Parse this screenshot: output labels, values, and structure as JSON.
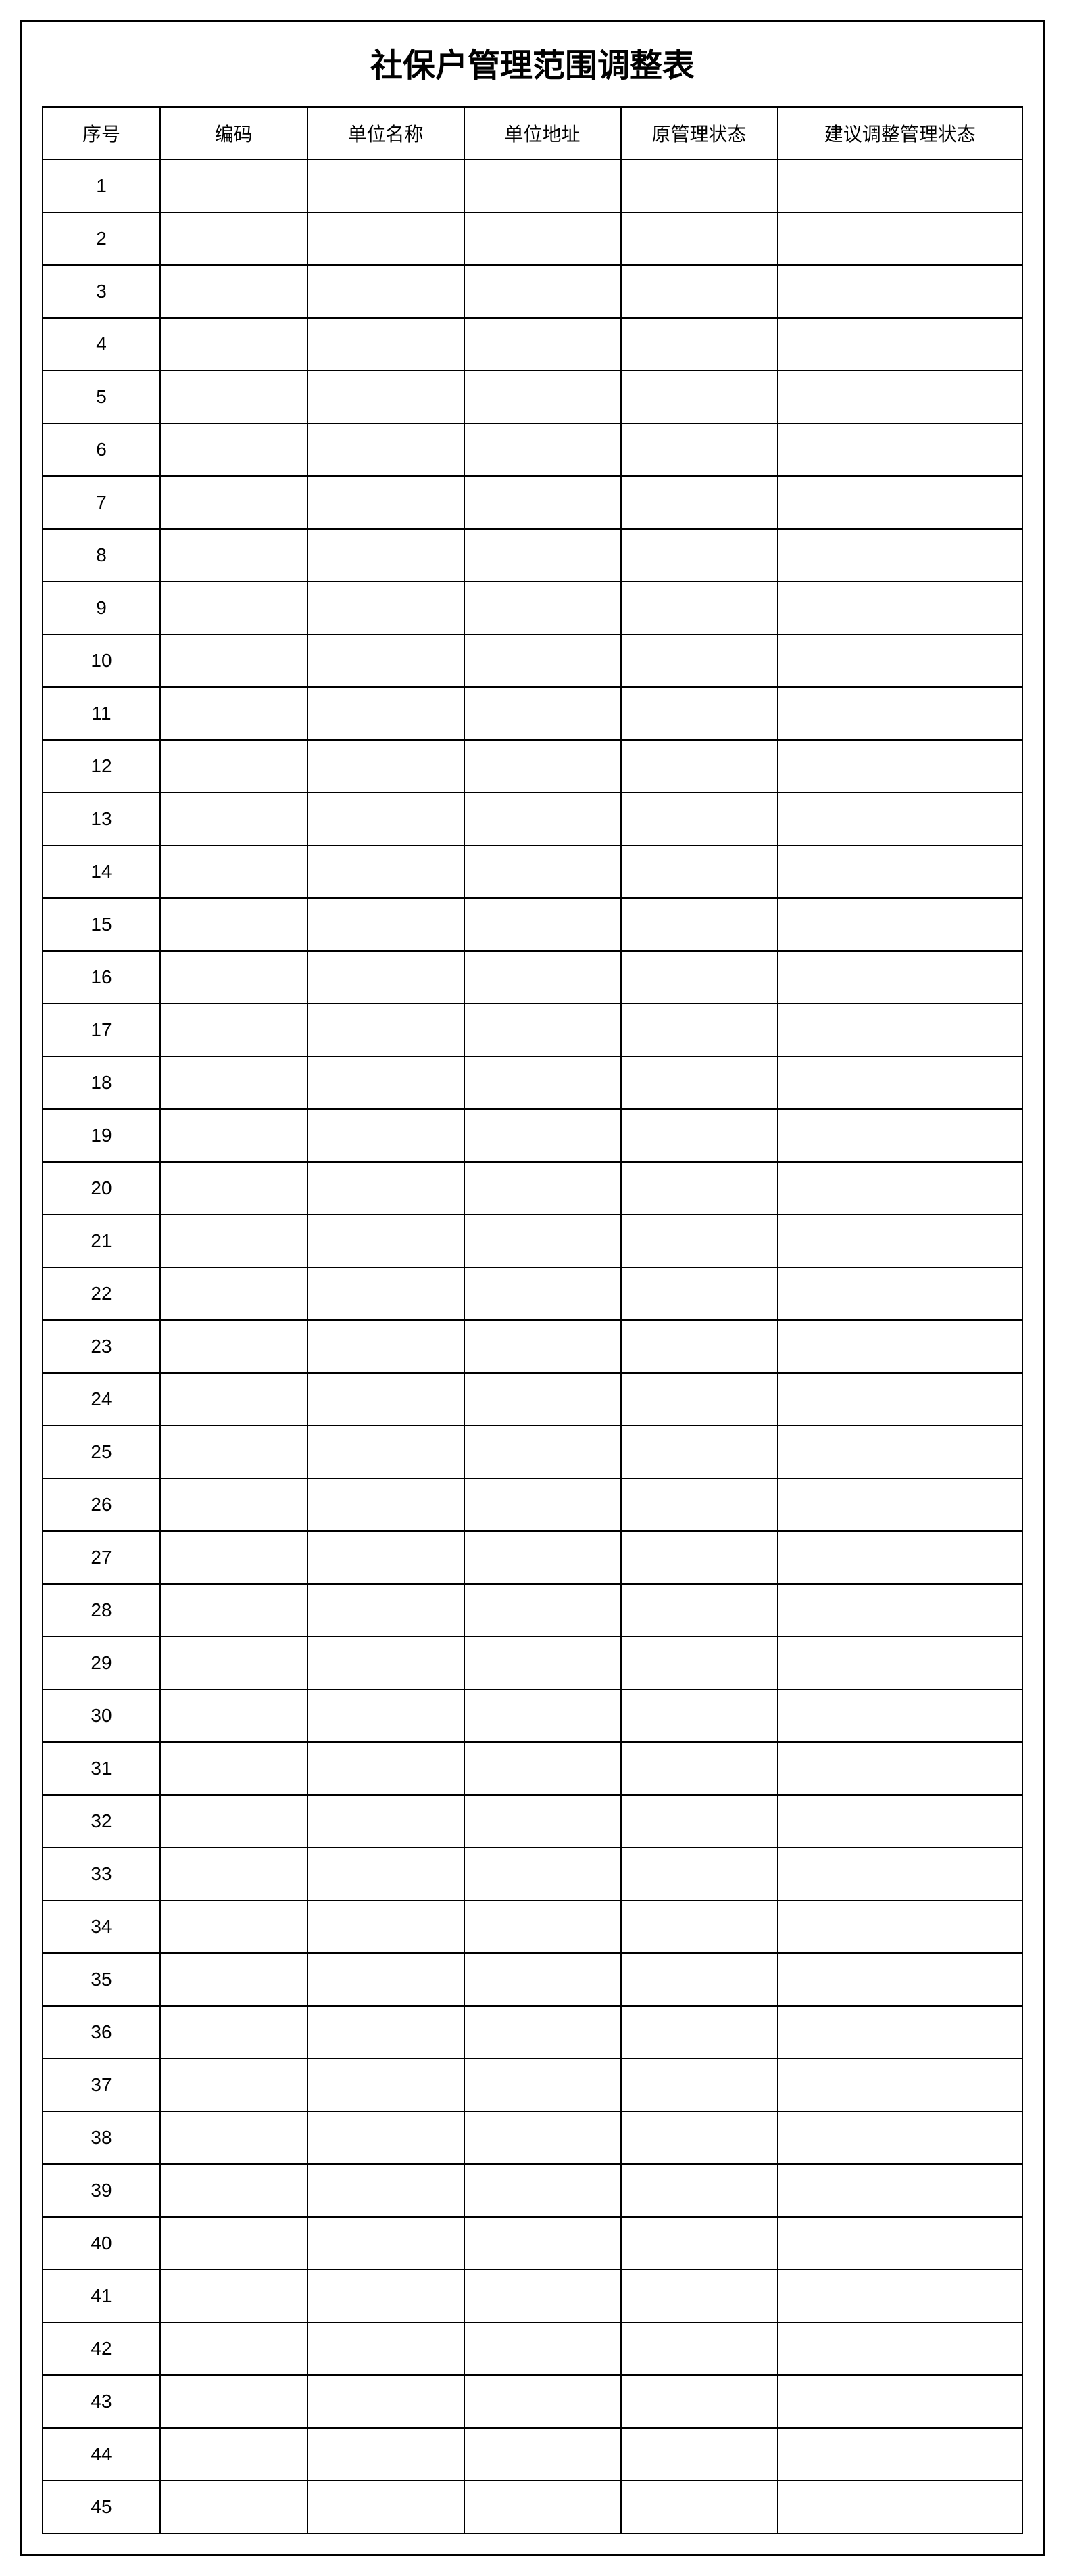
{
  "title": "社保户管理范围调整表",
  "columns": [
    {
      "key": "seq",
      "label": "序号"
    },
    {
      "key": "code",
      "label": "编码"
    },
    {
      "key": "unit_name",
      "label": "单位名称"
    },
    {
      "key": "unit_addr",
      "label": "单位地址"
    },
    {
      "key": "orig_status",
      "label": "原管理状态"
    },
    {
      "key": "suggest_status",
      "label": "建议调整管理状态"
    }
  ],
  "rows": [
    {
      "seq": "1",
      "code": "",
      "unit_name": "",
      "unit_addr": "",
      "orig_status": "",
      "suggest_status": ""
    },
    {
      "seq": "2",
      "code": "",
      "unit_name": "",
      "unit_addr": "",
      "orig_status": "",
      "suggest_status": ""
    },
    {
      "seq": "3",
      "code": "",
      "unit_name": "",
      "unit_addr": "",
      "orig_status": "",
      "suggest_status": ""
    },
    {
      "seq": "4",
      "code": "",
      "unit_name": "",
      "unit_addr": "",
      "orig_status": "",
      "suggest_status": ""
    },
    {
      "seq": "5",
      "code": "",
      "unit_name": "",
      "unit_addr": "",
      "orig_status": "",
      "suggest_status": ""
    },
    {
      "seq": "6",
      "code": "",
      "unit_name": "",
      "unit_addr": "",
      "orig_status": "",
      "suggest_status": ""
    },
    {
      "seq": "7",
      "code": "",
      "unit_name": "",
      "unit_addr": "",
      "orig_status": "",
      "suggest_status": ""
    },
    {
      "seq": "8",
      "code": "",
      "unit_name": "",
      "unit_addr": "",
      "orig_status": "",
      "suggest_status": ""
    },
    {
      "seq": "9",
      "code": "",
      "unit_name": "",
      "unit_addr": "",
      "orig_status": "",
      "suggest_status": ""
    },
    {
      "seq": "10",
      "code": "",
      "unit_name": "",
      "unit_addr": "",
      "orig_status": "",
      "suggest_status": ""
    },
    {
      "seq": "11",
      "code": "",
      "unit_name": "",
      "unit_addr": "",
      "orig_status": "",
      "suggest_status": ""
    },
    {
      "seq": "12",
      "code": "",
      "unit_name": "",
      "unit_addr": "",
      "orig_status": "",
      "suggest_status": ""
    },
    {
      "seq": "13",
      "code": "",
      "unit_name": "",
      "unit_addr": "",
      "orig_status": "",
      "suggest_status": ""
    },
    {
      "seq": "14",
      "code": "",
      "unit_name": "",
      "unit_addr": "",
      "orig_status": "",
      "suggest_status": ""
    },
    {
      "seq": "15",
      "code": "",
      "unit_name": "",
      "unit_addr": "",
      "orig_status": "",
      "suggest_status": ""
    },
    {
      "seq": "16",
      "code": "",
      "unit_name": "",
      "unit_addr": "",
      "orig_status": "",
      "suggest_status": ""
    },
    {
      "seq": "17",
      "code": "",
      "unit_name": "",
      "unit_addr": "",
      "orig_status": "",
      "suggest_status": ""
    },
    {
      "seq": "18",
      "code": "",
      "unit_name": "",
      "unit_addr": "",
      "orig_status": "",
      "suggest_status": ""
    },
    {
      "seq": "19",
      "code": "",
      "unit_name": "",
      "unit_addr": "",
      "orig_status": "",
      "suggest_status": ""
    },
    {
      "seq": "20",
      "code": "",
      "unit_name": "",
      "unit_addr": "",
      "orig_status": "",
      "suggest_status": ""
    },
    {
      "seq": "21",
      "code": "",
      "unit_name": "",
      "unit_addr": "",
      "orig_status": "",
      "suggest_status": ""
    },
    {
      "seq": "22",
      "code": "",
      "unit_name": "",
      "unit_addr": "",
      "orig_status": "",
      "suggest_status": ""
    },
    {
      "seq": "23",
      "code": "",
      "unit_name": "",
      "unit_addr": "",
      "orig_status": "",
      "suggest_status": ""
    },
    {
      "seq": "24",
      "code": "",
      "unit_name": "",
      "unit_addr": "",
      "orig_status": "",
      "suggest_status": ""
    },
    {
      "seq": "25",
      "code": "",
      "unit_name": "",
      "unit_addr": "",
      "orig_status": "",
      "suggest_status": ""
    },
    {
      "seq": "26",
      "code": "",
      "unit_name": "",
      "unit_addr": "",
      "orig_status": "",
      "suggest_status": ""
    },
    {
      "seq": "27",
      "code": "",
      "unit_name": "",
      "unit_addr": "",
      "orig_status": "",
      "suggest_status": ""
    },
    {
      "seq": "28",
      "code": "",
      "unit_name": "",
      "unit_addr": "",
      "orig_status": "",
      "suggest_status": ""
    },
    {
      "seq": "29",
      "code": "",
      "unit_name": "",
      "unit_addr": "",
      "orig_status": "",
      "suggest_status": ""
    },
    {
      "seq": "30",
      "code": "",
      "unit_name": "",
      "unit_addr": "",
      "orig_status": "",
      "suggest_status": ""
    },
    {
      "seq": "31",
      "code": "",
      "unit_name": "",
      "unit_addr": "",
      "orig_status": "",
      "suggest_status": ""
    },
    {
      "seq": "32",
      "code": "",
      "unit_name": "",
      "unit_addr": "",
      "orig_status": "",
      "suggest_status": ""
    },
    {
      "seq": "33",
      "code": "",
      "unit_name": "",
      "unit_addr": "",
      "orig_status": "",
      "suggest_status": ""
    },
    {
      "seq": "34",
      "code": "",
      "unit_name": "",
      "unit_addr": "",
      "orig_status": "",
      "suggest_status": ""
    },
    {
      "seq": "35",
      "code": "",
      "unit_name": "",
      "unit_addr": "",
      "orig_status": "",
      "suggest_status": ""
    },
    {
      "seq": "36",
      "code": "",
      "unit_name": "",
      "unit_addr": "",
      "orig_status": "",
      "suggest_status": ""
    },
    {
      "seq": "37",
      "code": "",
      "unit_name": "",
      "unit_addr": "",
      "orig_status": "",
      "suggest_status": ""
    },
    {
      "seq": "38",
      "code": "",
      "unit_name": "",
      "unit_addr": "",
      "orig_status": "",
      "suggest_status": ""
    },
    {
      "seq": "39",
      "code": "",
      "unit_name": "",
      "unit_addr": "",
      "orig_status": "",
      "suggest_status": ""
    },
    {
      "seq": "40",
      "code": "",
      "unit_name": "",
      "unit_addr": "",
      "orig_status": "",
      "suggest_status": ""
    },
    {
      "seq": "41",
      "code": "",
      "unit_name": "",
      "unit_addr": "",
      "orig_status": "",
      "suggest_status": ""
    },
    {
      "seq": "42",
      "code": "",
      "unit_name": "",
      "unit_addr": "",
      "orig_status": "",
      "suggest_status": ""
    },
    {
      "seq": "43",
      "code": "",
      "unit_name": "",
      "unit_addr": "",
      "orig_status": "",
      "suggest_status": ""
    },
    {
      "seq": "44",
      "code": "",
      "unit_name": "",
      "unit_addr": "",
      "orig_status": "",
      "suggest_status": ""
    },
    {
      "seq": "45",
      "code": "",
      "unit_name": "",
      "unit_addr": "",
      "orig_status": "",
      "suggest_status": ""
    }
  ]
}
